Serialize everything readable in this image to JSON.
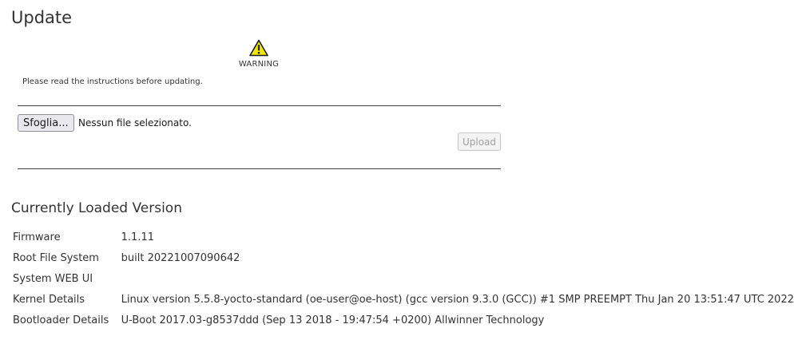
{
  "page": {
    "title": "Update"
  },
  "warning": {
    "icon": "warning-triangle-icon",
    "label": "WARNING",
    "color": "#f2e600"
  },
  "instructions": "Please read the instructions before updating.",
  "upload_form": {
    "browse_label": "Sfoglia...",
    "file_status": "Nessun file selezionato.",
    "upload_label": "Upload",
    "upload_disabled": true
  },
  "version_section": {
    "title": "Currently Loaded Version",
    "rows": [
      {
        "label": "Firmware",
        "value": "1.1.11"
      },
      {
        "label": "Root File System",
        "value": "built 20221007090642"
      },
      {
        "label": "System WEB UI",
        "value": ""
      },
      {
        "label": "Kernel Details",
        "value": "Linux version 5.5.8-yocto-standard (oe-user@oe-host) (gcc version 9.3.0 (GCC)) #1 SMP PREEMPT Thu Jan 20 13:51:47 UTC 2022"
      },
      {
        "label": "Bootloader Details",
        "value": "U-Boot 2017.03-g8537ddd (Sep 13 2018 - 19:47:54 +0200) Allwinner Technology"
      }
    ]
  }
}
